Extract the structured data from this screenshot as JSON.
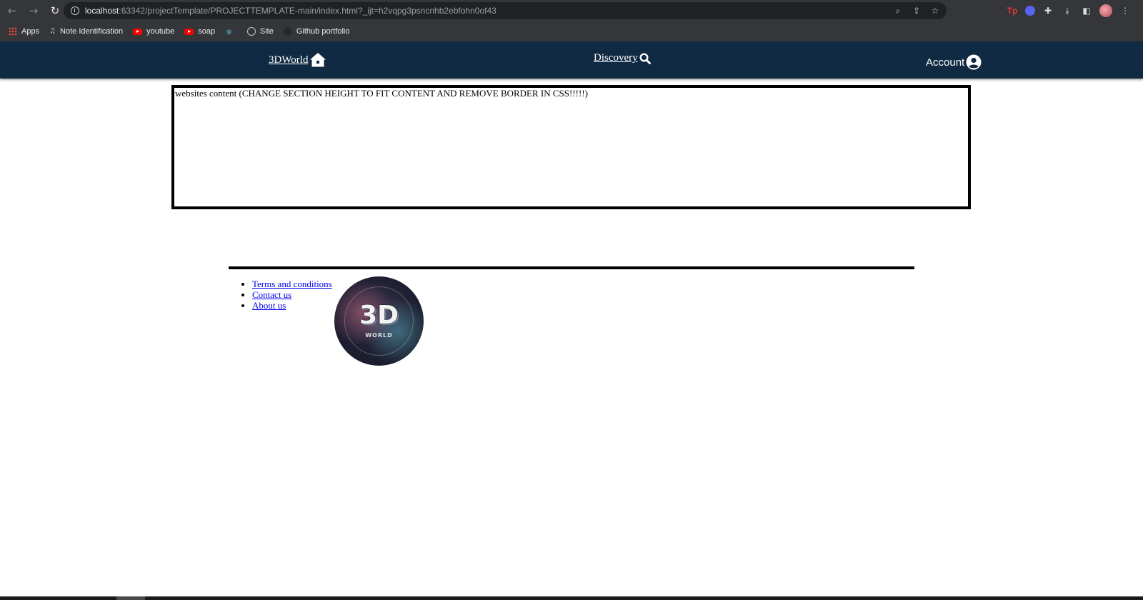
{
  "browser": {
    "url_host": "localhost",
    "url_rest": ":63342/projectTemplate/PROJECTTEMPLATE-main/index.html?_ijt=h2vqpg3psncnhb2ebfohn0of43",
    "bookmarks": [
      {
        "label": "Apps",
        "icon": "apps-icon"
      },
      {
        "label": "Note Identification",
        "icon": "note-icon"
      },
      {
        "label": "youtube",
        "icon": "youtube-icon"
      },
      {
        "label": "soap",
        "icon": "youtube-icon"
      },
      {
        "label": "",
        "icon": "react-icon"
      },
      {
        "label": "Site",
        "icon": "globe-icon"
      },
      {
        "label": "Github portfolio",
        "icon": "github-icon"
      }
    ],
    "extensions": {
      "tp": "Tp"
    }
  },
  "nav": {
    "home_label": "3DWorld",
    "discovery_label": "Discovery",
    "account_label": "Account",
    "background": "#102a43"
  },
  "content": {
    "text": "websites content (CHANGE SECTION HEIGHT TO FIT CONTENT AND REMOVE BORDER IN CSS!!!!!)"
  },
  "footer": {
    "links": [
      "Terms and conditions",
      "Contact us",
      "About us"
    ],
    "logo": {
      "main": "3D",
      "sub": "WORLD"
    }
  }
}
